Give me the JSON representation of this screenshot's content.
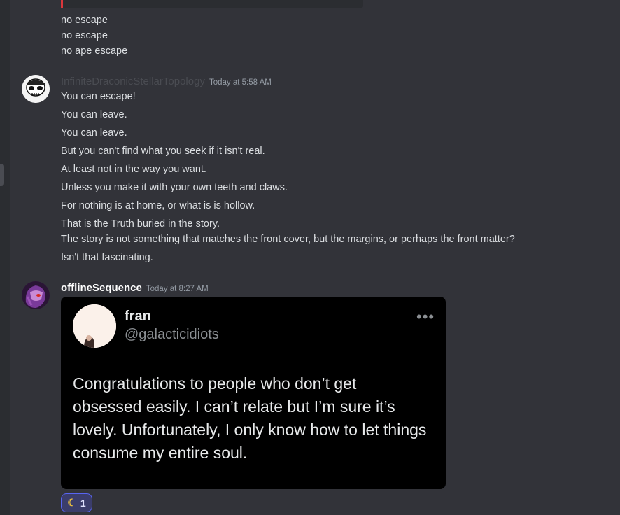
{
  "prev_messages": [
    "no escape",
    "no escape",
    "no ape escape"
  ],
  "message1": {
    "author": "InfiniteDraconicStellarTopology",
    "timestamp": "Today at 5:58 AM",
    "author_color": "#4a4c52",
    "lines": [
      "You can escape!",
      "You can leave.",
      "You can leave.",
      "But you can't find what you seek if it isn't real.",
      "At least not in the way you want.",
      "Unless you make it with your own teeth and claws.",
      "For nothing is at home, or what is is hollow.",
      "That is the Truth buried in the story.",
      "The story is not something that matches the front cover, but the margins, or perhaps the front matter?",
      "Isn't that fascinating."
    ]
  },
  "message2": {
    "author": "offlineSequence",
    "timestamp": "Today at 8:27 AM",
    "author_color": "#ffffff",
    "tweet": {
      "name": "fran",
      "handle": "@galacticidiots",
      "more_icon": "•••",
      "text": "Congratulations to people who don’t get obsessed easily. I can’t relate but I’m sure it’s lovely. Unfortunately, I only know how to let things consume my entire soul."
    },
    "reaction": {
      "emoji": "moon-icon",
      "count": "1"
    }
  }
}
